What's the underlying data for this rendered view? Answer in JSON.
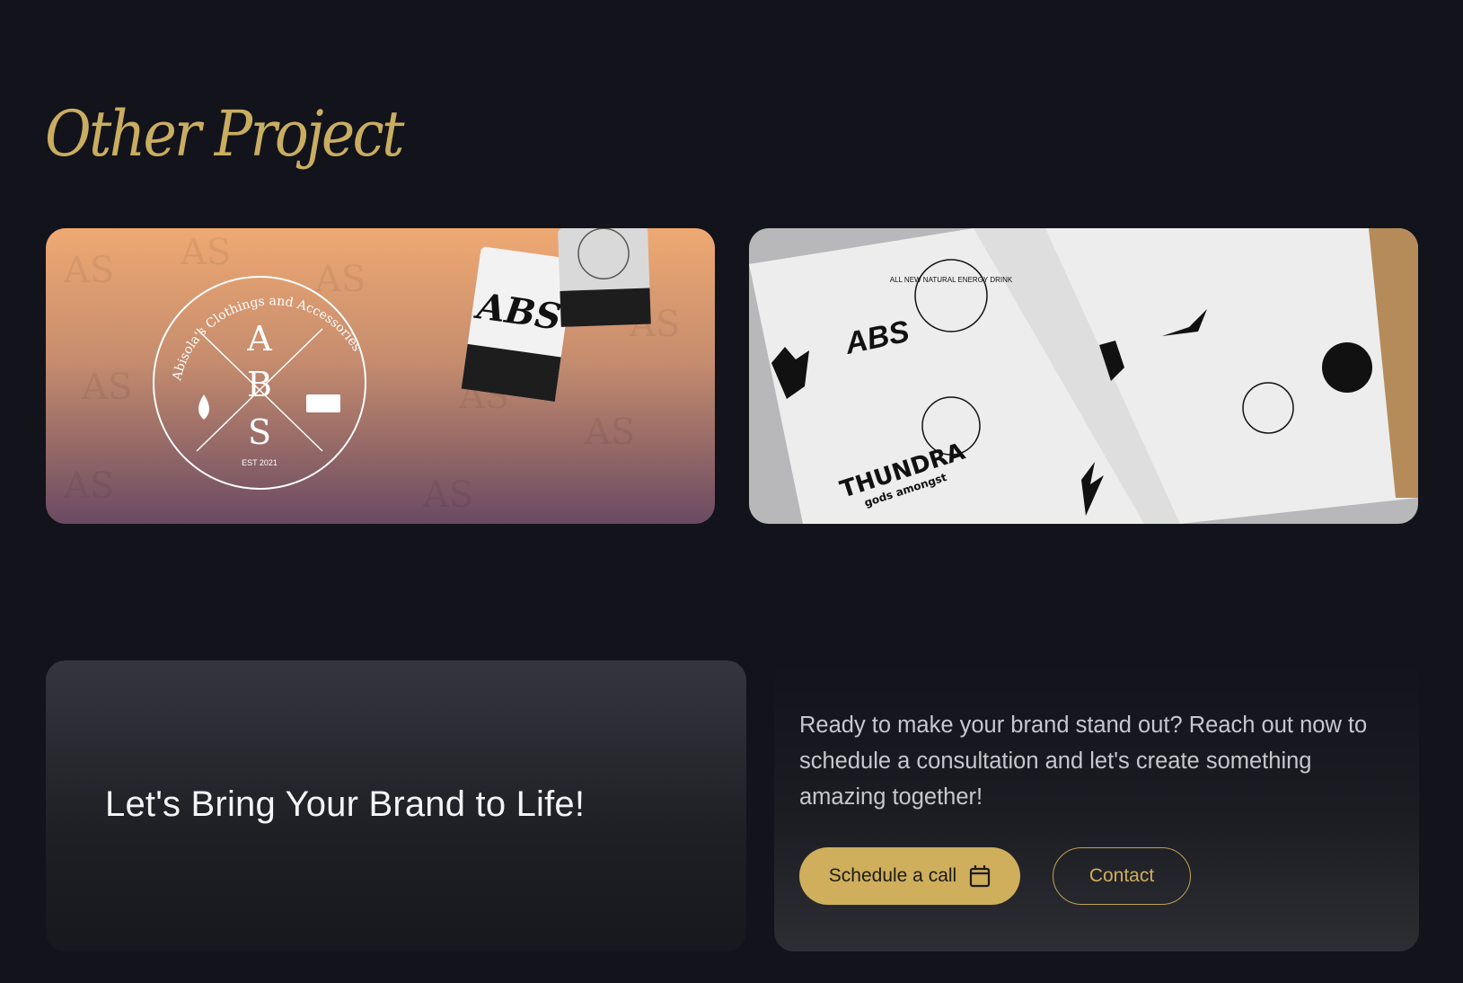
{
  "section": {
    "title": "Other Project"
  },
  "projects": [
    {
      "logo_arc_text": "Abisola's Clothings and Accessories",
      "logo_letters": [
        "A",
        "B",
        "S"
      ],
      "logo_est": "EST 2021",
      "tag_text": "ABS"
    },
    {
      "logo_labels": [
        "ABS",
        "THUNDRA",
        "gods amongst",
        "ALL NEW NATURAL ENERGY DRINK"
      ]
    }
  ],
  "cta": {
    "heading": "Let's Bring Your Brand to Life!",
    "text": "Ready to make your brand stand out? Reach out now to schedule a consultation and let's create something amazing together!",
    "schedule_label": "Schedule a call",
    "contact_label": "Contact"
  },
  "colors": {
    "accent": "#cfae5c",
    "background": "#12131b"
  },
  "icons": {
    "schedule": "calendar-icon"
  }
}
